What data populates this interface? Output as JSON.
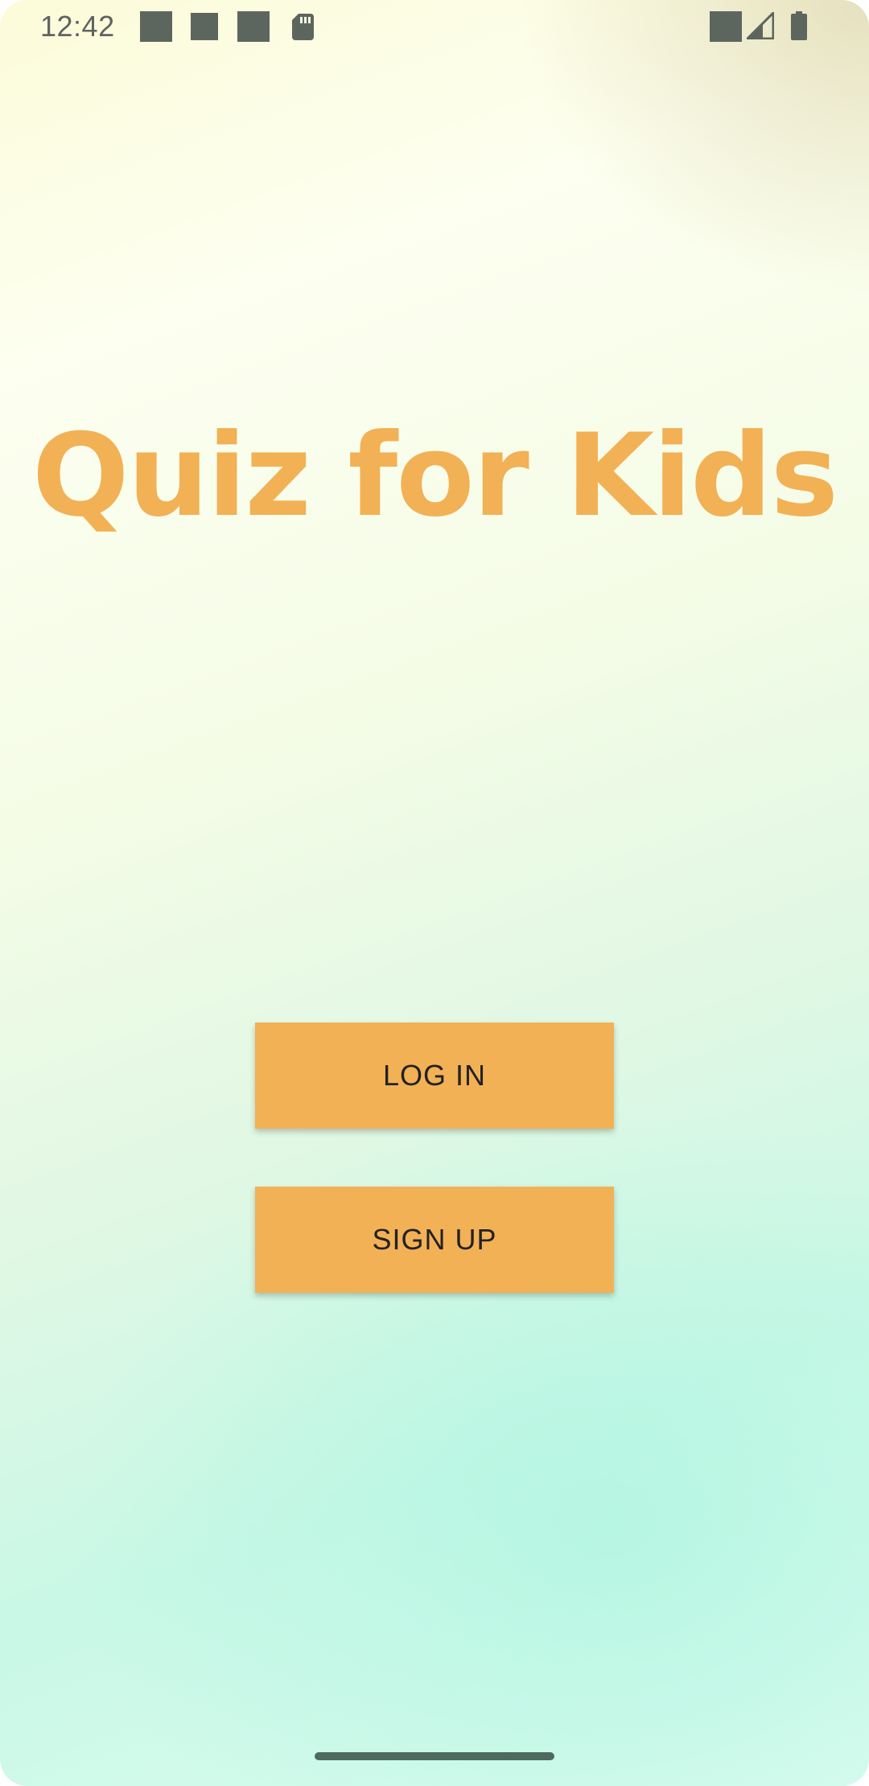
{
  "status_bar": {
    "time": "12:42",
    "left_icons": [
      "image-icon",
      "image-icon",
      "image-icon",
      "sd-card-icon"
    ],
    "right_icons": [
      "wifi-icon",
      "signal-icon",
      "battery-icon"
    ],
    "icon_color": "#5d665e"
  },
  "app": {
    "title": "Quiz for Kids",
    "title_color": "#f2b155"
  },
  "actions": {
    "login_label": "LOG IN",
    "signup_label": "SIGN UP",
    "button_color": "#f3b156"
  },
  "nav": {
    "handle_icon": "gesture-nav-handle"
  }
}
